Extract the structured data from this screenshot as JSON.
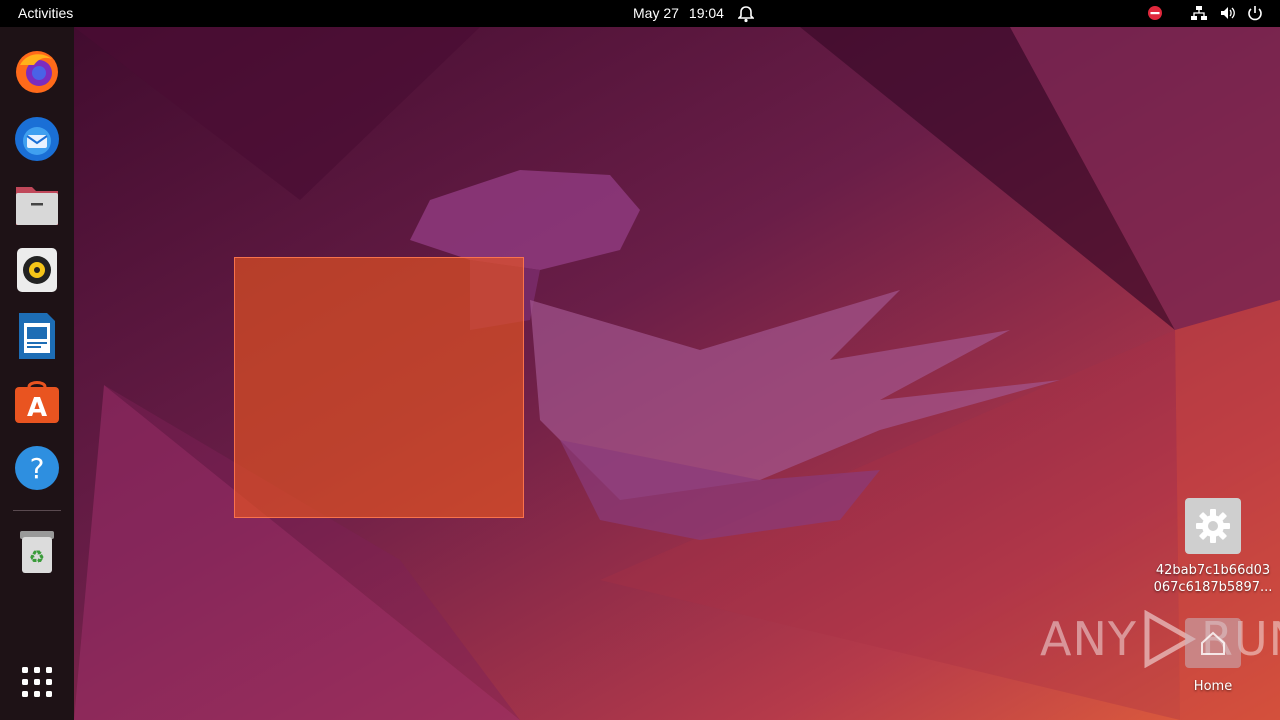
{
  "topbar": {
    "activities_label": "Activities",
    "date": "May 27",
    "time": "19:04",
    "icons": [
      "notification-bell-icon",
      "do-not-disturb-icon",
      "network-icon",
      "volume-icon",
      "power-icon"
    ]
  },
  "dock": {
    "apps": [
      {
        "name": "Firefox",
        "icon": "firefox-icon"
      },
      {
        "name": "Thunderbird",
        "icon": "thunderbird-icon"
      },
      {
        "name": "Files",
        "icon": "files-icon"
      },
      {
        "name": "Rhythmbox",
        "icon": "rhythmbox-icon"
      },
      {
        "name": "LibreOffice Writer",
        "icon": "writer-icon"
      },
      {
        "name": "Ubuntu Software",
        "icon": "software-icon"
      },
      {
        "name": "Help",
        "icon": "help-icon"
      },
      {
        "name": "Trash",
        "icon": "trash-icon"
      }
    ],
    "show_apps_icon": "app-grid-icon"
  },
  "desktop": {
    "file_icon": {
      "label_line1": "42bab7c1b66d03",
      "label_line2": "067c6187b5897..."
    },
    "home_icon": {
      "label": "Home"
    },
    "watermark_left": "ANY",
    "watermark_right": "RUN"
  },
  "colors": {
    "accent": "#E95420",
    "topbar": "#000000",
    "dock": "#1E1216"
  }
}
